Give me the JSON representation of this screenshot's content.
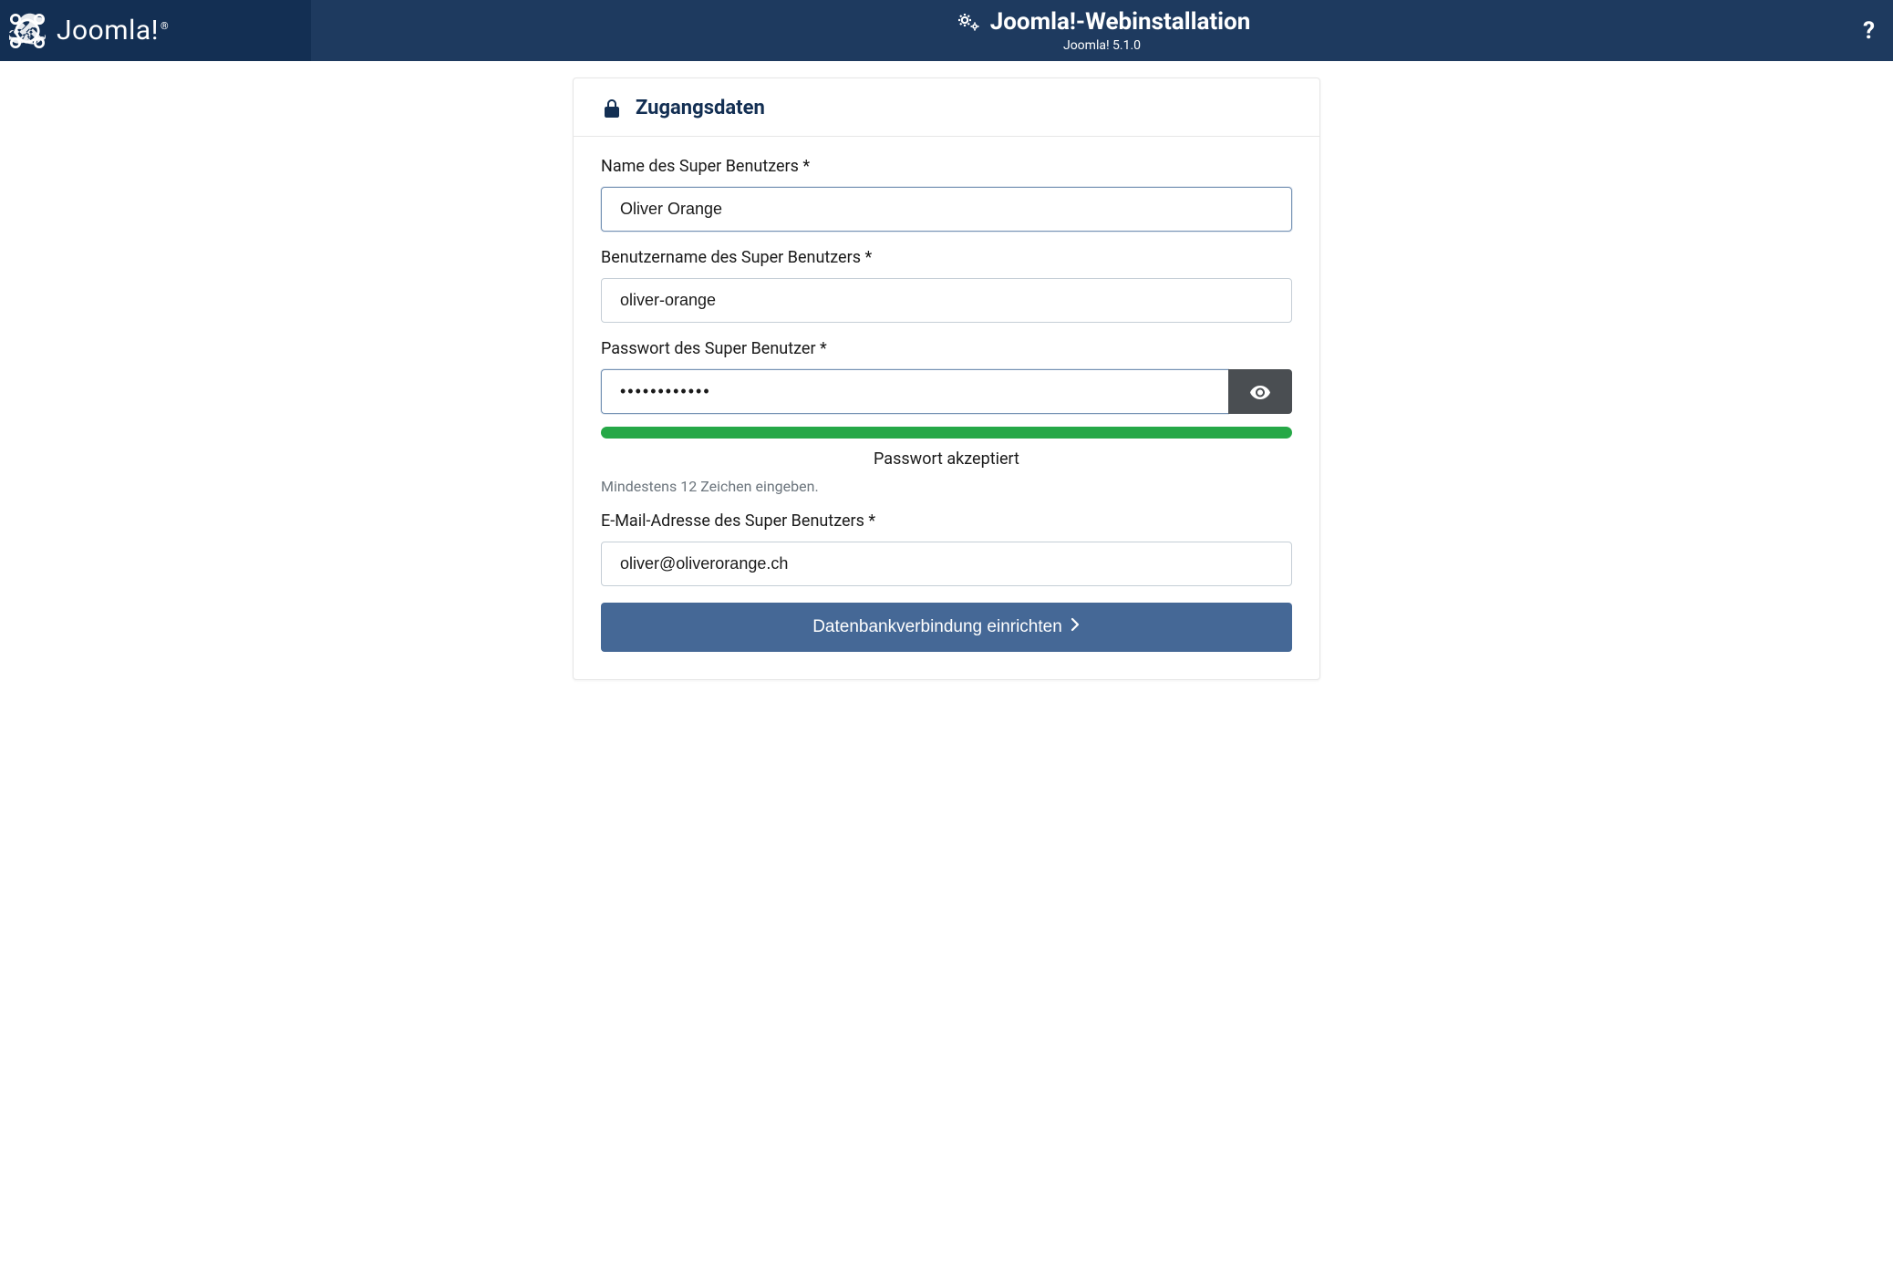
{
  "header": {
    "brand": "Joomla!",
    "title": "Joomla!-Webinstallation",
    "version": "Joomla! 5.1.0",
    "help": "?"
  },
  "card": {
    "title": "Zugangsdaten"
  },
  "form": {
    "name": {
      "label": "Name des Super Benutzers *",
      "value": "Oliver Orange"
    },
    "username": {
      "label": "Benutzername des Super Benutzers *",
      "value": "oliver-orange"
    },
    "password": {
      "label": "Passwort des Super Benutzer *",
      "value": "••••••••••••",
      "status": "Passwort akzeptiert",
      "hint": "Mindestens 12 Zeichen eingeben."
    },
    "email": {
      "label": "E-Mail-Adresse des Super Benutzers *",
      "value": "oliver@oliverorange.ch"
    },
    "submit": "Datenbankverbindung einrichten"
  }
}
